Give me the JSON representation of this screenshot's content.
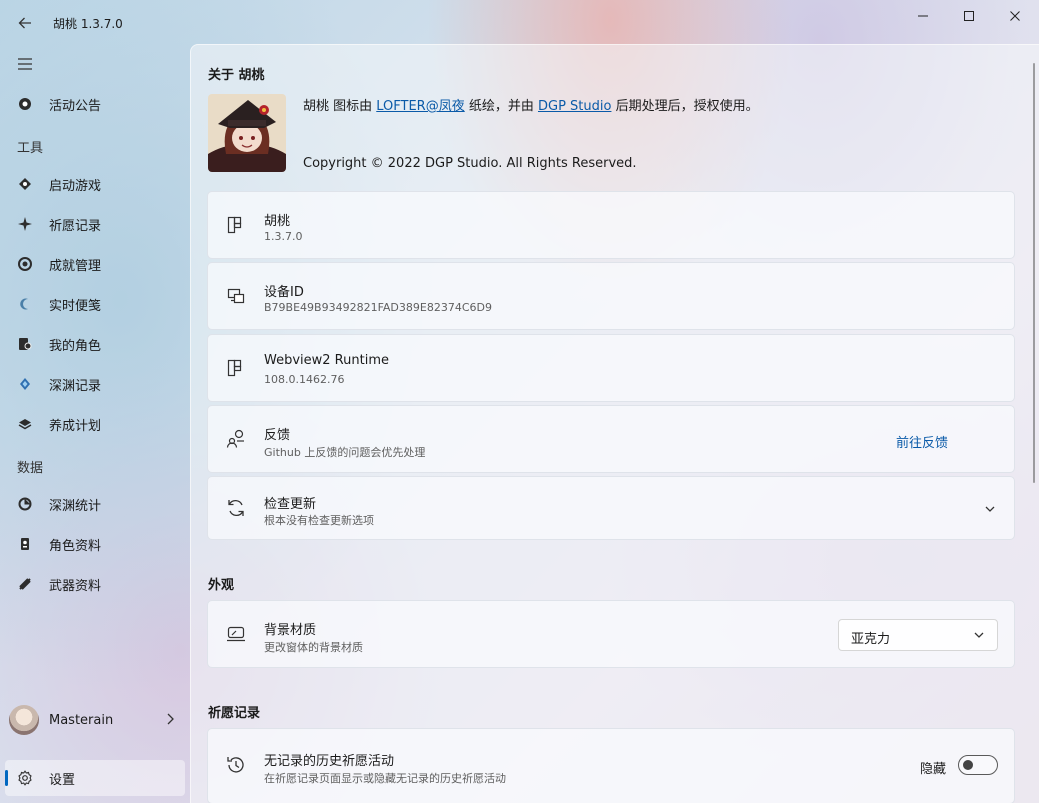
{
  "titlebar": {
    "title": "胡桃 1.3.7.0"
  },
  "sidebar": {
    "items": [
      {
        "label": "活动公告",
        "icon": "announcement-icon"
      },
      {
        "label": "启动游戏",
        "icon": "launch-game-icon"
      },
      {
        "label": "祈愿记录",
        "icon": "wish-sparkle-icon"
      },
      {
        "label": "成就管理",
        "icon": "achievement-icon"
      },
      {
        "label": "实时便笺",
        "icon": "realtime-note-icon"
      },
      {
        "label": "我的角色",
        "icon": "my-characters-icon"
      },
      {
        "label": "深渊记录",
        "icon": "abyss-record-icon"
      },
      {
        "label": "养成计划",
        "icon": "cultivation-plan-icon"
      },
      {
        "label": "深渊统计",
        "icon": "abyss-stats-icon"
      },
      {
        "label": "角色资料",
        "icon": "character-wiki-icon"
      },
      {
        "label": "武器资料",
        "icon": "weapon-wiki-icon"
      }
    ],
    "sections": {
      "tools": "工具",
      "data": "数据"
    },
    "profile": {
      "name": "Masterain"
    },
    "settings": {
      "label": "设置"
    }
  },
  "about": {
    "heading": "关于 胡桃",
    "line_prefix": "胡桃 图标由 ",
    "artist_link": "LOFTER@凤夜",
    "line_mid": " 纸绘，并由 ",
    "studio_link": "DGP Studio",
    "line_suffix": " 后期处理后，授权使用。",
    "copyright": "Copyright © 2022 DGP Studio. All Rights Reserved."
  },
  "cards": {
    "app": {
      "title": "胡桃",
      "subtitle": "1.3.7.0"
    },
    "device": {
      "title": "设备ID",
      "subtitle": "B79BE49B93492821FAD389E82374C6D9"
    },
    "webview": {
      "title": "Webview2 Runtime",
      "subtitle": "108.0.1462.76"
    },
    "feedback": {
      "title": "反馈",
      "subtitle": "Github 上反馈的问题会优先处理",
      "action": "前往反馈"
    },
    "update": {
      "title": "检查更新",
      "subtitle": "根本没有检查更新选项"
    }
  },
  "appearance": {
    "heading": "外观",
    "backdrop": {
      "title": "背景材质",
      "subtitle": "更改窗体的背景材质",
      "selected": "亚克力"
    }
  },
  "wish": {
    "heading": "祈愿记录",
    "history": {
      "title": "无记录的历史祈愿活动",
      "subtitle": "在祈愿记录页面显示或隐藏无记录的历史祈愿活动",
      "toggle_label": "隐藏",
      "toggle_on": false
    }
  },
  "colors": {
    "accent": "#0067c0",
    "link": "#0a5aa8"
  }
}
